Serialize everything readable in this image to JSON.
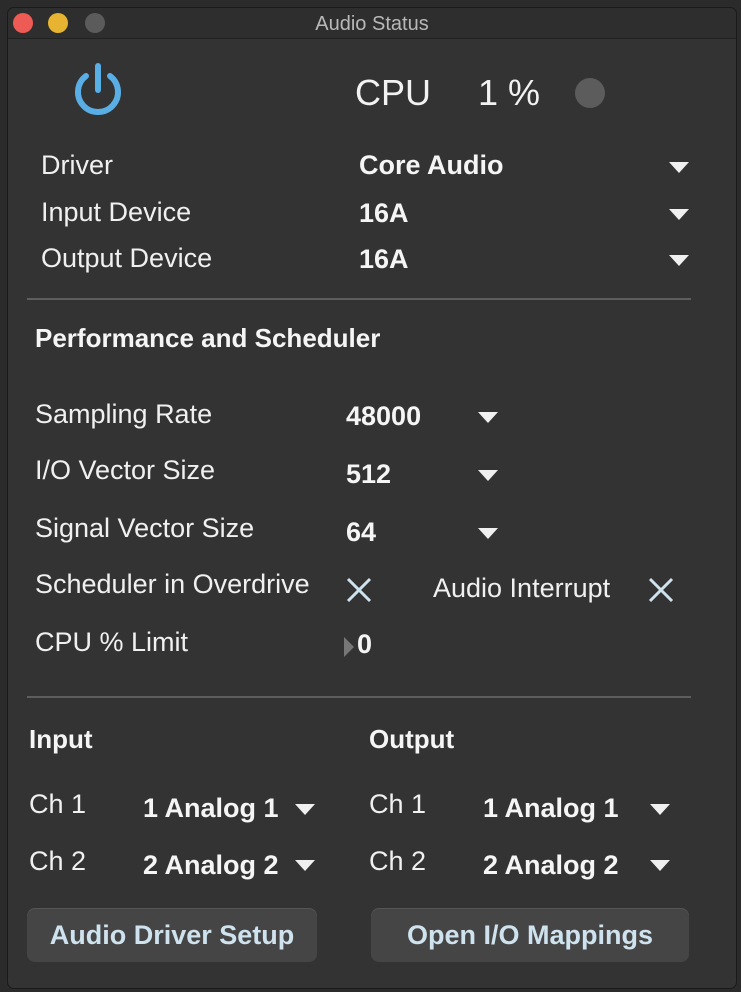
{
  "window": {
    "title": "Audio Status"
  },
  "header": {
    "cpu_label": "CPU",
    "cpu_value": "1 %"
  },
  "device": {
    "driver_label": "Driver",
    "driver_value": "Core Audio",
    "input_label": "Input Device",
    "input_value": "16A",
    "output_label": "Output Device",
    "output_value": "16A"
  },
  "performance": {
    "heading": "Performance and Scheduler",
    "sampling_rate_label": "Sampling Rate",
    "sampling_rate_value": "48000",
    "io_vector_label": "I/O Vector Size",
    "io_vector_value": "512",
    "signal_vector_label": "Signal Vector Size",
    "signal_vector_value": "64",
    "overdrive_label": "Scheduler in Overdrive",
    "interrupt_label": "Audio Interrupt",
    "cpu_limit_label": "CPU % Limit",
    "cpu_limit_value": "0"
  },
  "io": {
    "input_heading": "Input",
    "output_heading": "Output",
    "input_ch1_label": "Ch 1",
    "input_ch1_value": "1 Analog 1",
    "input_ch2_label": "Ch 2",
    "input_ch2_value": "2 Analog 2",
    "output_ch1_label": "Ch 1",
    "output_ch1_value": "1 Analog 1",
    "output_ch2_label": "Ch 2",
    "output_ch2_value": "2 Analog 2"
  },
  "buttons": {
    "driver_setup": "Audio Driver Setup",
    "io_mappings": "Open I/O Mappings"
  },
  "colors": {
    "accent": "#5aaee6",
    "window_bg": "#333333",
    "button_text": "#cfe3ee"
  }
}
